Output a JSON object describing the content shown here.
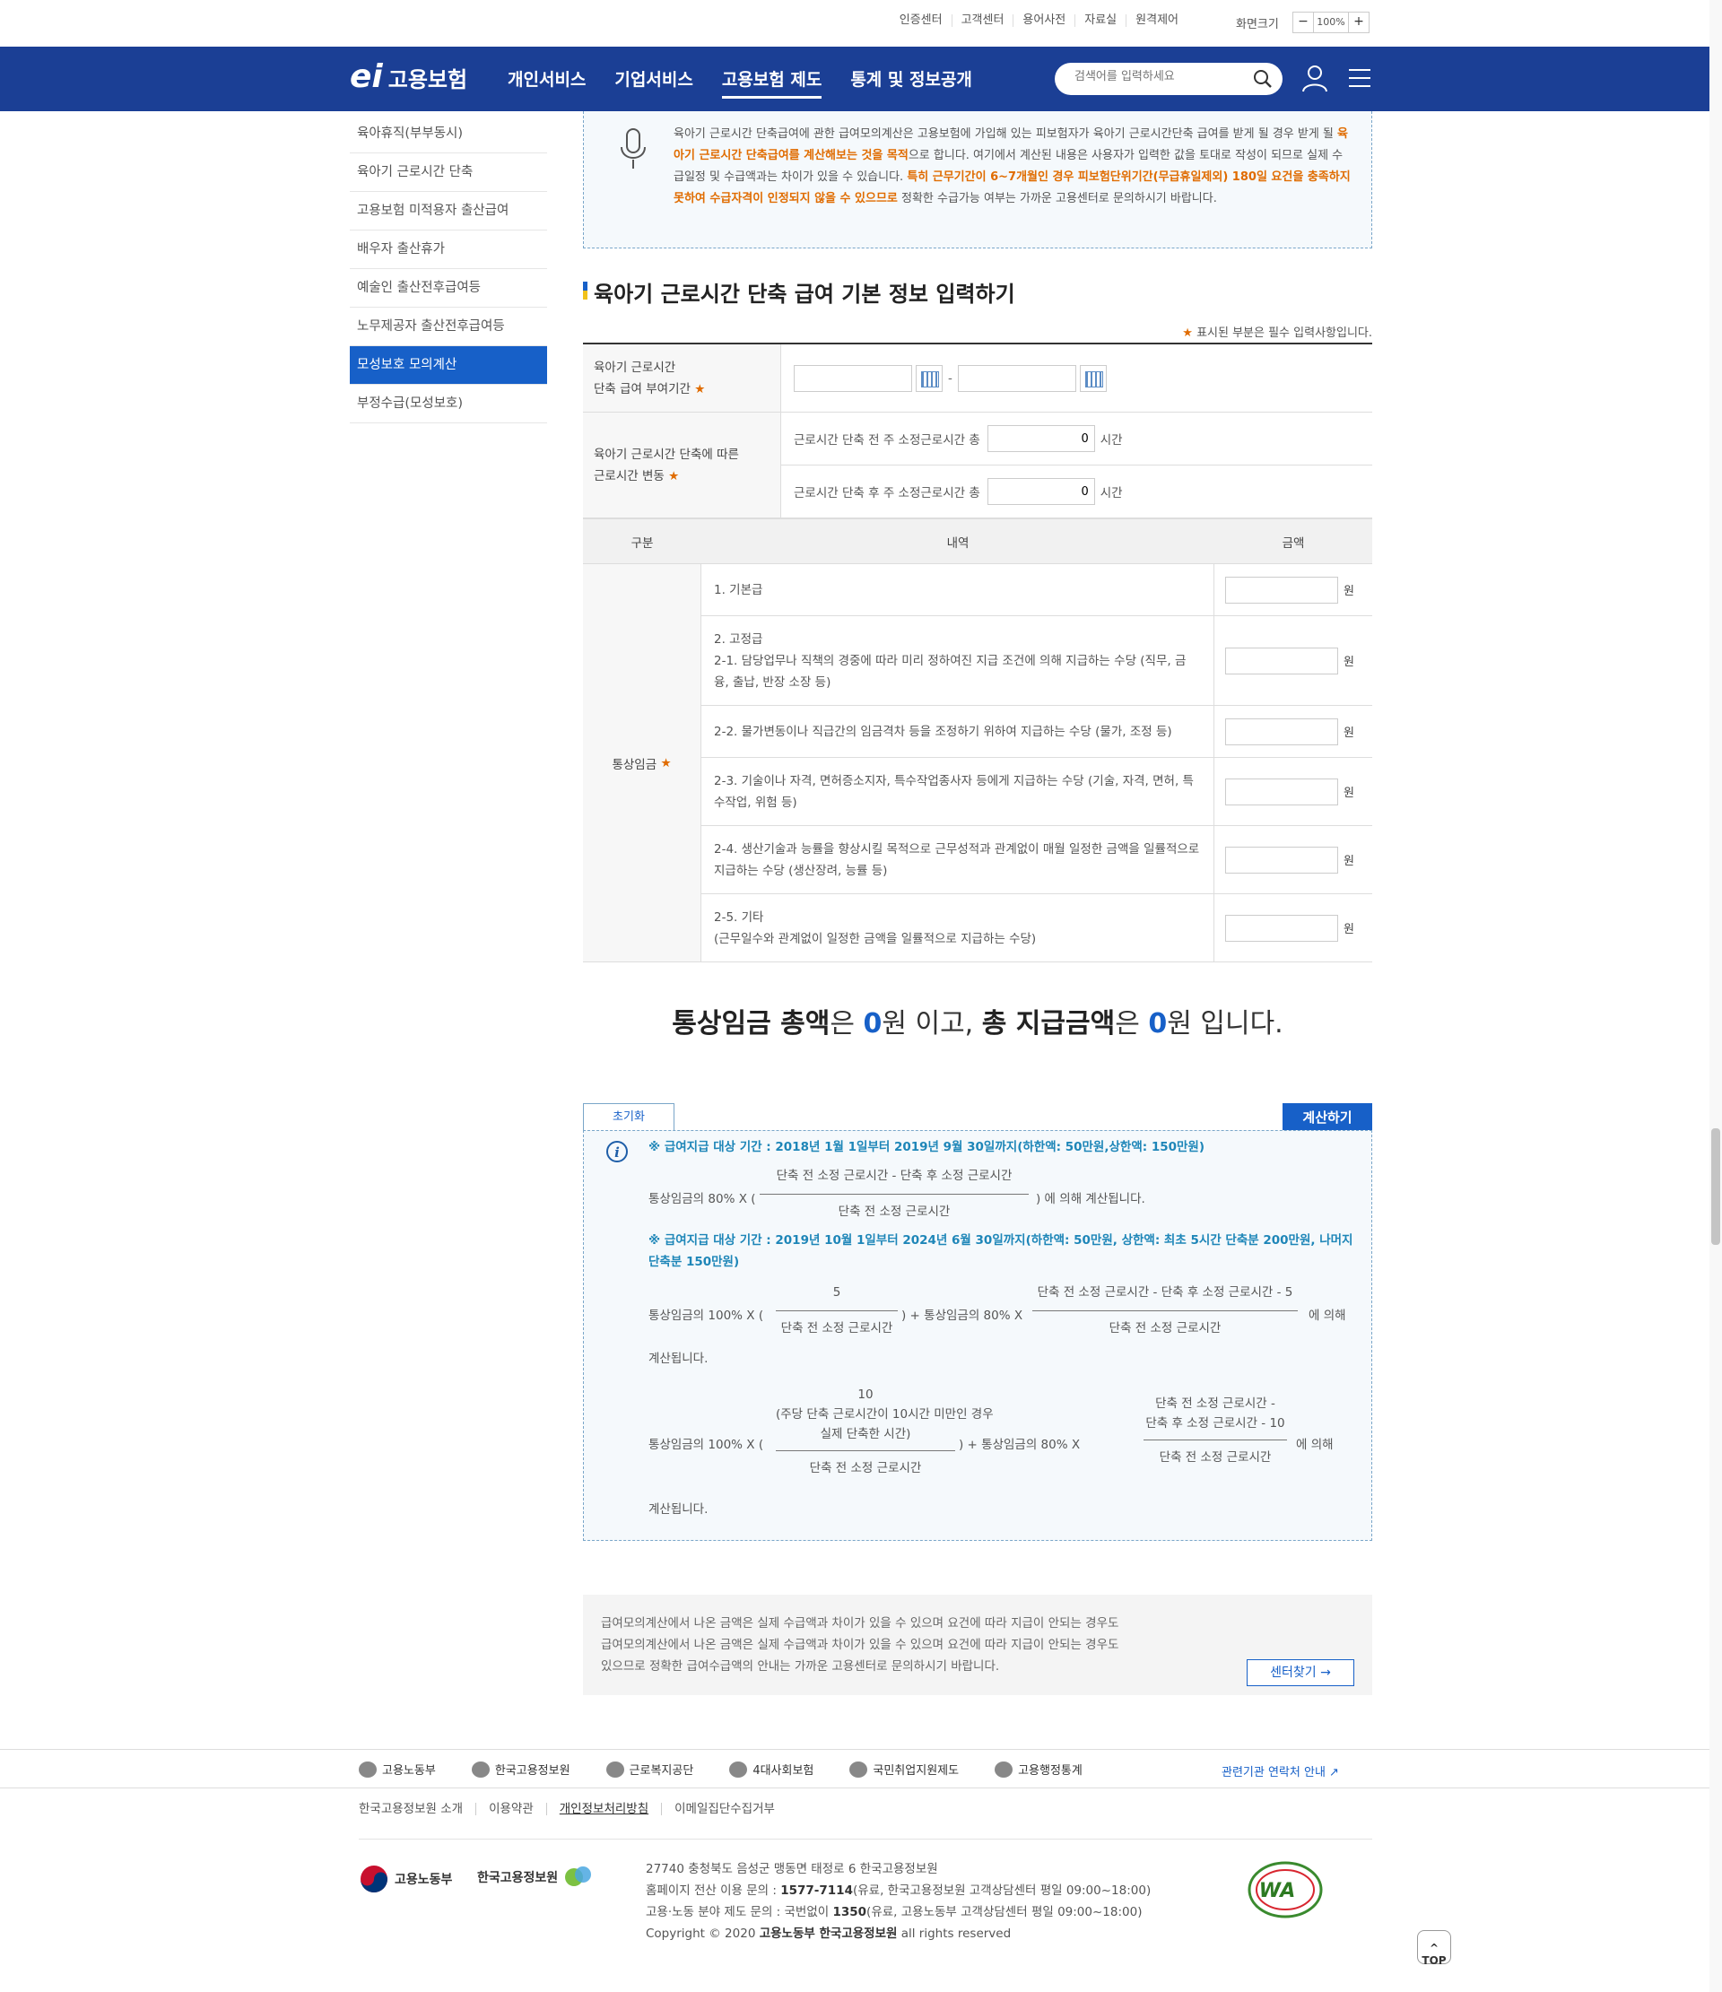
{
  "util": {
    "links": [
      "인증센터",
      "고객센터",
      "용어사전",
      "자료실",
      "원격제어"
    ],
    "zoom_label": "화면크기",
    "zoom_minus": "−",
    "zoom_value": "100%",
    "zoom_plus": "+"
  },
  "header": {
    "logo_mark": "ei",
    "logo_text": "고용보험",
    "nav": [
      "개인서비스",
      "기업서비스",
      "고용보험 제도",
      "통계 및 정보공개"
    ],
    "nav_active": 2,
    "search_placeholder": "검색어를 입력하세요"
  },
  "lnb": {
    "items": [
      "육아휴직(부부동시)",
      "육아기 근로시간 단축",
      "고용보험 미적용자 출산급여",
      "배우자 출산휴가",
      "예술인 출산전후급여등",
      "노무제공자 출산전후급여등",
      "모성보호 모의계산",
      "부정수급(모성보호)"
    ],
    "active": 6
  },
  "notice": {
    "p1": "육아기 근로시간 단축급여에 관한 급여모의계산은 고용보험에 가입해 있는 피보험자가 육아기 근로시간단축 급여를 받게 될 경우 받게 될 ",
    "p1_em": "육아기 근로시간 단축급여를 계산해보는 것을 목적",
    "p2": "으로 합니다. 여기에서 계산된 내용은 사용자가 입력한 값을 토대로 작성이 되므로 실제 수급일정 및 수급액과는 차이가 있을 수 있습니다. ",
    "p2_em": "특히 근무기간이 6~7개월인 경우 피보험단위기간(무급휴일제외) 180일 요건을 충족하지 못하여 수급자격이 인정되지 않을 수 있으므로",
    "p3": " 정확한 수급가능 여부는 가까운 고용센터로 문의하시기 바랍니다."
  },
  "section": {
    "title": "육아기 근로시간 단축 급여 기본 정보 입력하기",
    "req_star": "★",
    "req_text": " 표시된 부분은 필수 입력사항입니다."
  },
  "form": {
    "period_label1": "육아기 근로시간",
    "period_label2": "단축 급여 부여기간",
    "change_label1": "육아기 근로시간 단축에 따른",
    "change_label2": "근로시간 변동",
    "before_label": "근로시간 단축 전 주 소정근로시간 총",
    "before_value": "0",
    "after_label": "근로시간 단축 후 주 소정근로시간 총",
    "after_value": "0",
    "hour_unit": "시간",
    "date_sep": "-",
    "star": "★"
  },
  "wage": {
    "headers": [
      "구분",
      "내역",
      "금액"
    ],
    "category": "통상임금",
    "unit": "원",
    "rows": [
      [
        "1. 기본급"
      ],
      [
        "2. 고정급",
        "2-1. 담당업무나 직책의 경중에 따라 미리 정하여진 지급 조건에 의해 지급하는 수당 (직무, 금융, 출납, 반장 소장 등)"
      ],
      [
        "2-2. 물가변동이나 직급간의 임금격차 등을 조정하기 위하여 지급하는 수당 (물가, 조정 등)"
      ],
      [
        "2-3. 기술이나 자격, 면허증소지자, 특수작업종사자 등에게 지급하는 수당 (기술, 자격, 면허, 특수작업, 위험 등)"
      ],
      [
        "2-4. 생산기술과 능률을 향상시킬 목적으로 근무성적과 관계없이 매월 일정한 금액을 일률적으로 지급하는 수당 (생산장려, 능률 등)"
      ],
      [
        "2-5. 기타",
        "(근무일수와 관계없이 일정한 금액을 일률적으로 지급하는 수당)"
      ]
    ]
  },
  "total": {
    "a": "통상임금 총액",
    "b": "은 ",
    "v1": "0",
    "c": "원 이고, ",
    "d": "총 지급금액",
    "e": "은 ",
    "v2": "0",
    "f": "원 입니다."
  },
  "calc": {
    "reset": "초기화",
    "calculate": "계산하기",
    "p1": "※ 급여지급 대상 기간 : 2018년 1월 1일부터 2019년 9월 30일까지(하한액: 50만원,상한액: 150만원)",
    "f1_prefix": "통상임금의 80% X (",
    "f1_num": "단축 전 소정 근로시간 - 단축 후 소정 근로시간",
    "f1_den": "단축 전 소정 근로시간",
    "f1_suffix": ") 에 의해 계산됩니다.",
    "p2a": "※ 급여지급 대상 기간 : 2019년 10월 1일부터 2024년 6월 30일까지(하한액: 50만원, 상한액: 최초 5시간 단축분 200만원, 나머지",
    "p2b": "단축분 150만원)",
    "f2_prefix": "통상임금의 100% X (",
    "f2_num1": "5",
    "f2_den1": "단축 전 소정 근로시간",
    "f2_mid": ") + 통상임금의 80% X",
    "f2_num2": "단축 전 소정 근로시간 - 단축 후 소정 근로시간 - 5",
    "f2_den2": "단축 전 소정 근로시간",
    "f2_suffix": "에 의해",
    "f2_tail": "계산됩니다.",
    "f3_prefix": "통상임금의 100% X (",
    "f3_num1a": "10",
    "f3_num1b": "(주당 단축 근로시간이 10시간 미만인 경우",
    "f3_num1c": "실제 단축한 시간)",
    "f3_den1": "단축 전 소정 근로시간",
    "f3_mid": ") + 통상임금의 80% X",
    "f3_num2a": "단축 전 소정 근로시간 -",
    "f3_num2b": "단축 후 소정 근로시간 - 10",
    "f3_den2": "단축 전 소정 근로시간",
    "f3_suffix": "에 의해",
    "f3_tail": "계산됩니다."
  },
  "bottom": {
    "l1": "급여모의계산에서 나온 금액은 실제 수급액과 차이가 있을 수 있으며 요건에 따라 지급이 안되는 경우도",
    "l2": "급여모의계산에서 나온 금액은 실제 수급액과 차이가 있을 수 있으며 요건에 따라 지급이 안되는 경우도",
    "l3": "있으므로 정확한 급여수급액의 안내는 가까운 고용센터로 문의하시기 바랍니다.",
    "center_btn": "센터찾기 →"
  },
  "footer": {
    "family": [
      "고용노동부",
      "한국고용정보원",
      "근로복지공단",
      "4대사회보험",
      "국민취업지원제도",
      "고용행정통계"
    ],
    "family_link": "관련기관 연락처 안내",
    "links": [
      "한국고용정보원 소개",
      "이용약관",
      "개인정보처리방침",
      "이메일집단수집거부"
    ],
    "logo1": "고용노동부",
    "logo2": "한국고용정보원",
    "addr1": "27740 충청북도 음성군 맹동면 태정로 6 한국고용정보원",
    "addr2a": "홈페이지 전산 이용 문의 : ",
    "addr2b": "1577-7114",
    "addr2c": "(유료, 한국고용정보원 고객상담센터 평일 09:00~18:00)",
    "addr3a": "고용·노동 분야 제도 문의 : 국번없이 ",
    "addr3b": "1350",
    "addr3c": "(유료, 고용노동부 고객상담센터 평일 09:00~18:00)",
    "addr4a": "Copyright © 2020 ",
    "addr4b": "고용노동부 한국고용정보원",
    "addr4c": " all rights reserved",
    "wa_label": "WA",
    "top": "TOP"
  }
}
